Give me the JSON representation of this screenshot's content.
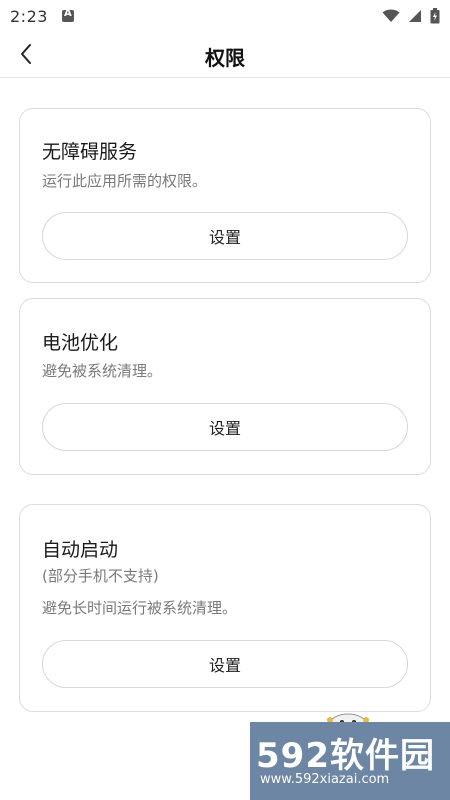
{
  "status_bar": {
    "time": "2:23",
    "icons": [
      "notification-a-icon",
      "wifi-icon",
      "signal-icon",
      "battery-icon"
    ]
  },
  "header": {
    "title": "权限",
    "back_icon": "chevron-left-icon"
  },
  "cards": [
    {
      "title": "无障碍服务",
      "description": "运行此应用所需的权限。",
      "button": "设置"
    },
    {
      "title": "电池优化",
      "description": "避免被系统清理。",
      "button": "设置"
    },
    {
      "title": "自动启动",
      "note": "(部分手机不支持)",
      "description": "避免长时间运行被系统清理。",
      "button": "设置"
    }
  ],
  "watermark": {
    "brand": "592软件园",
    "url": "www.592xiazai.com",
    "color": "#6d86a3"
  }
}
